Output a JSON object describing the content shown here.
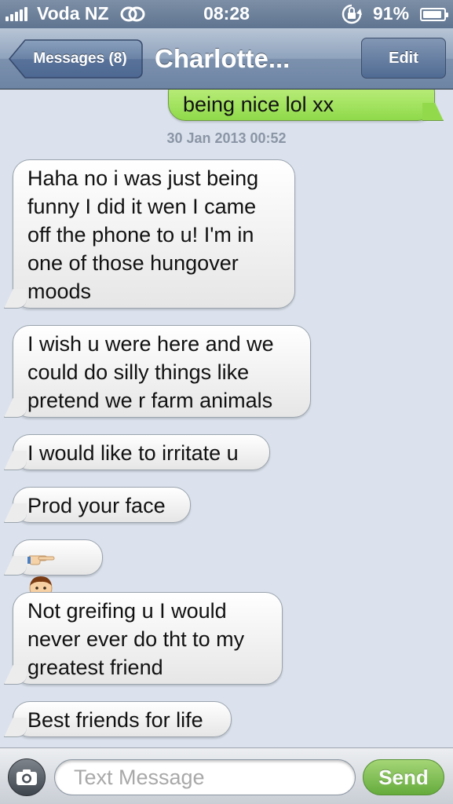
{
  "status_bar": {
    "carrier": "Voda NZ",
    "time": "08:28",
    "battery_percent": "91%",
    "battery_level": 0.91,
    "signal_bars": 5
  },
  "nav": {
    "back_label": "Messages (8)",
    "title": "Charlotte...",
    "edit_label": "Edit"
  },
  "conversation": {
    "sent_partial": "being nice lol xx",
    "timestamp": "30 Jan 2013 00:52",
    "messages": [
      {
        "lines": [
          "Haha no i was just being",
          "funny I did it wen I came",
          "off the phone to u! I'm in",
          "one of those hungover",
          "moods"
        ]
      },
      {
        "lines": [
          "I wish u were here and we",
          "could do silly things like",
          "pretend we r farm animals"
        ]
      },
      {
        "lines": [
          "I would like to irritate u"
        ]
      },
      {
        "lines": [
          "Prod your face"
        ]
      },
      {
        "emoji": [
          "pointing-hand-icon",
          "boy-face-icon"
        ]
      },
      {
        "lines": [
          "Not greifing u I would",
          "never ever do tht to my",
          "greatest friend"
        ]
      },
      {
        "lines": [
          "Best friends for life"
        ]
      }
    ]
  },
  "input_bar": {
    "placeholder": "Text Message",
    "send_label": "Send"
  },
  "colors": {
    "background": "#dbe2ed",
    "sent_bubble": "#8fd94a",
    "received_bubble": "#ffffff",
    "nav_bar": "#7b91ae"
  }
}
